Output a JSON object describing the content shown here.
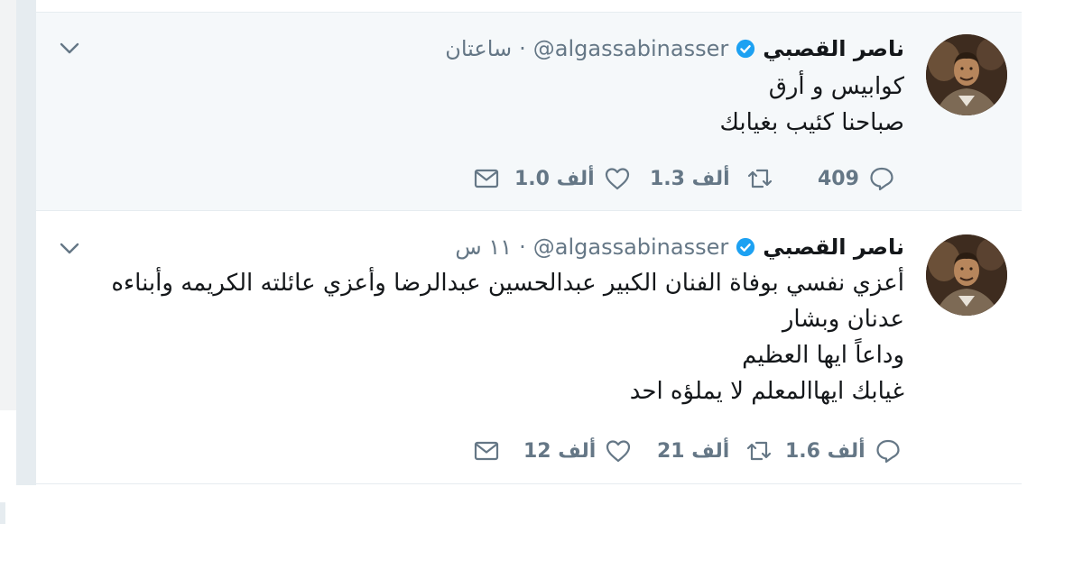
{
  "tweets": [
    {
      "name": "ناصر القصبي",
      "handle": "@algassabinasser",
      "separator": "·",
      "time": "ساعتان",
      "lines": [
        "كوابيس و أرق",
        "صباحنا كئيب بغيابك"
      ],
      "replies": "409",
      "retweets": "1.3 ألف",
      "likes": "1.0 ألف"
    },
    {
      "name": "ناصر القصبي",
      "handle": "@algassabinasser",
      "separator": "·",
      "time": "١١ س",
      "lines": [
        "أعزي نفسي بوفاة الفنان الكبير عبدالحسين عبدالرضا وأعزي عائلته الكريمه وأبناءه",
        "عدنان وبشار",
        "وداعاً ايها العظيم",
        "غيابك ايهاالمعلم لا يملؤه احد"
      ],
      "replies": "1.6 ألف",
      "retweets": "21 ألف",
      "likes": "12 ألف"
    }
  ],
  "icons": {
    "verified": "verified-badge-icon",
    "chevron": "chevron-down-icon",
    "reply": "reply-icon",
    "retweet": "retweet-icon",
    "like": "heart-icon",
    "message": "envelope-icon"
  },
  "colors": {
    "verified": "#1da1f2",
    "muted": "#657786",
    "text": "#14171a",
    "highlight_bg": "#f5f8fa",
    "border": "#e6ecf0"
  }
}
